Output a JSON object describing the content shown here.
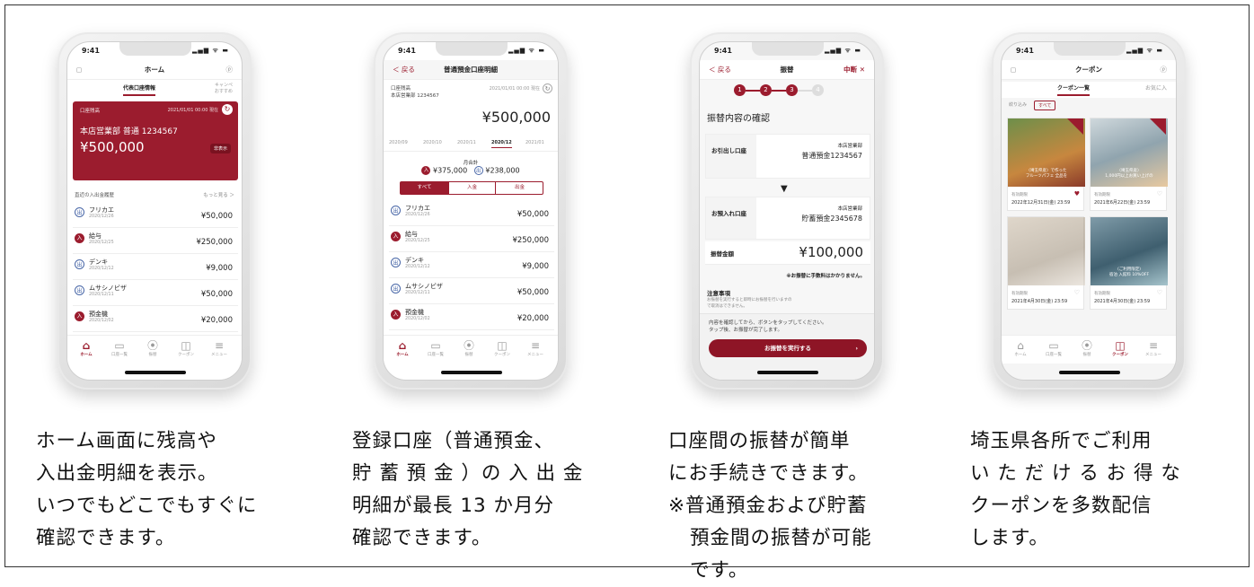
{
  "status_time": "9:41",
  "status_icons": "▂▄▆ ᯤ ▬",
  "phone1": {
    "title": "ホーム",
    "tabs": [
      "代表口座情報",
      "キャンペ\nおすすめ"
    ],
    "card": {
      "label": "口座残高",
      "timestamp": "2021/01/01 00:00 現在",
      "account": "本店営業部 普通 1234567",
      "balance": "¥500,000",
      "hide_label": "非表示"
    },
    "history_label": "直近の入出金履歴",
    "more_label": "もっと見る ＞",
    "transactions": [
      {
        "name": "フリカエ",
        "date": "2020/12/26",
        "amount": "¥50,000",
        "type": "out",
        "badge": "出"
      },
      {
        "name": "給与",
        "date": "2020/12/25",
        "amount": "¥250,000",
        "type": "in",
        "badge": "入"
      },
      {
        "name": "デンキ",
        "date": "2020/12/12",
        "amount": "¥9,000",
        "type": "out",
        "badge": "出"
      },
      {
        "name": "ムサシノビザ",
        "date": "2020/12/11",
        "amount": "¥50,000",
        "type": "out",
        "badge": "出"
      },
      {
        "name": "預金機",
        "date": "2020/12/02",
        "amount": "¥20,000",
        "type": "in",
        "badge": "入"
      }
    ]
  },
  "tabbar": [
    {
      "label": "ホーム",
      "glyph": "⌂"
    },
    {
      "label": "口座一覧",
      "glyph": "▭"
    },
    {
      "label": "振替",
      "glyph": "⦿"
    },
    {
      "label": "クーポン",
      "glyph": "◫"
    },
    {
      "label": "メニュー",
      "glyph": "≡"
    }
  ],
  "phone2": {
    "back": "＜ 戻る",
    "title": "普通預金口座明細",
    "account_label": "口座残高",
    "account": "本店営業部 1234567",
    "timestamp": "2021/01/01 00:00 現在",
    "balance": "¥500,000",
    "months": [
      "2020/09",
      "2020/10",
      "2020/11",
      "2020/12",
      "2021/01"
    ],
    "monthly_total_label": "月合計",
    "in_total": "¥375,000",
    "out_total": "¥238,000",
    "segments": [
      "すべて",
      "入金",
      "出金"
    ],
    "transactions": [
      {
        "name": "フリカエ",
        "date": "2020/12/26",
        "amount": "¥50,000",
        "type": "out",
        "badge": "出"
      },
      {
        "name": "給与",
        "date": "2020/12/25",
        "amount": "¥250,000",
        "type": "in",
        "badge": "入"
      },
      {
        "name": "デンキ",
        "date": "2020/12/12",
        "amount": "¥9,000",
        "type": "out",
        "badge": "出"
      },
      {
        "name": "ムサシノビザ",
        "date": "2020/12/11",
        "amount": "¥50,000",
        "type": "out",
        "badge": "出"
      },
      {
        "name": "預金機",
        "date": "2020/12/02",
        "amount": "¥20,000",
        "type": "in",
        "badge": "入"
      }
    ]
  },
  "phone3": {
    "back": "＜ 戻る",
    "title": "振替",
    "cancel": "中断 ✕",
    "steps": [
      "1",
      "2",
      "3",
      "4"
    ],
    "heading": "振替内容の確認",
    "from_label": "お引出し口座",
    "from_branch": "本店営業部",
    "from_account": "普通預金1234567",
    "to_label": "お預入れ口座",
    "to_branch": "本店営業部",
    "to_account": "貯蓄預金2345678",
    "amount_label": "振替金額",
    "amount": "¥100,000",
    "fee_note": "※お振替に手数料はかかりません。",
    "notice_title": "注意事項",
    "notice_text": "お振替を実行すると即時にお振替を行いますの\nで取消はできません。",
    "confirm_text": "内容を確認してから、ボタンをタップしてください。\nタップ後、お振替が完了します。",
    "execute_button": "お振替を実行する"
  },
  "phone4": {
    "title": "クーポン",
    "tabs": [
      "クーポン一覧",
      "お気に入"
    ],
    "filter_label": "絞り込み",
    "filter_all": "すべて",
    "coupons": [
      {
        "caption": "〈埼玉県産〉で作った\nフルーツパフェ 全品を",
        "valid_label": "有効期限",
        "valid_date": "2022年12月31日(金) 23:59",
        "favorite": true
      },
      {
        "caption": "〈埼玉県産〉\n1,000円以上お買い上げの",
        "valid_label": "有効期限",
        "valid_date": "2021年6月22日(金) 23:59",
        "favorite": false
      },
      {
        "caption": "",
        "valid_label": "有効期限",
        "valid_date": "2021年4月30日(金) 23:59",
        "favorite": false
      },
      {
        "caption": "〈ご利用限定〉\n宿泊 入館料 10%OFF",
        "valid_label": "有効期限",
        "valid_date": "2021年4月30日(金) 23:59",
        "favorite": false
      }
    ]
  },
  "captions": [
    [
      "ホーム画面に残高や",
      "入出金明細を表示。",
      "いつでもどこでもすぐに",
      "確認できます。"
    ],
    [
      "登録口座（普通預金、",
      "貯 蓄 預 金 ）の 入 出 金",
      "明細が最長 13 か月分",
      "確認できます。"
    ],
    [
      "口座間の振替が簡単",
      "にお手続きできます。",
      "※普通預金および貯蓄",
      "預金間の振替が可能",
      "です。"
    ],
    [
      "埼玉県各所でご利用",
      "い た だ け る お 得 な",
      "クーポンを多数配信",
      "します。"
    ]
  ],
  "colors": {
    "brand": "#9b1c2e",
    "out_badge": "#4a68a8"
  }
}
